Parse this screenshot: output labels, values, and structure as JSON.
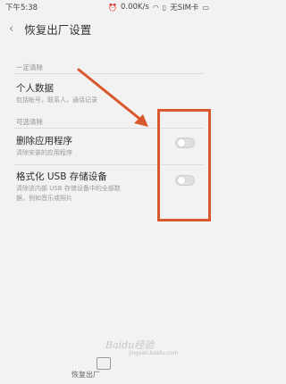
{
  "status_bar": {
    "time": "下午5:38",
    "speed": "0.00K/s",
    "carrier": "无SIM卡",
    "icons": [
      "alarm-icon",
      "wifi-icon",
      "no-sim-icon",
      "battery-icon"
    ]
  },
  "header": {
    "back_icon": "chevron-left-icon",
    "title": "恢复出厂设置"
  },
  "sections": {
    "must_clear": "一定清除",
    "optional_clear": "可选清除"
  },
  "items": {
    "personal_data": {
      "title": "个人数据",
      "desc": "包括帐号，联系人，通话记录"
    },
    "delete_apps": {
      "title": "删除应用程序",
      "desc": "清除安装的应用程序",
      "enabled": false
    },
    "format_usb": {
      "title": "格式化 USB 存储设备",
      "desc_line1": "清除该内部 USB 存储设备中的全部数",
      "desc_line2": "据，例如音乐或照片",
      "enabled": false
    }
  },
  "bottom": {
    "button_label": "恢复出厂"
  },
  "watermark": {
    "text": "Baidu经验",
    "url": "jingyan.baidu.com"
  },
  "colors": {
    "annotation": "#d9582e",
    "background": "#f2f2f2"
  }
}
